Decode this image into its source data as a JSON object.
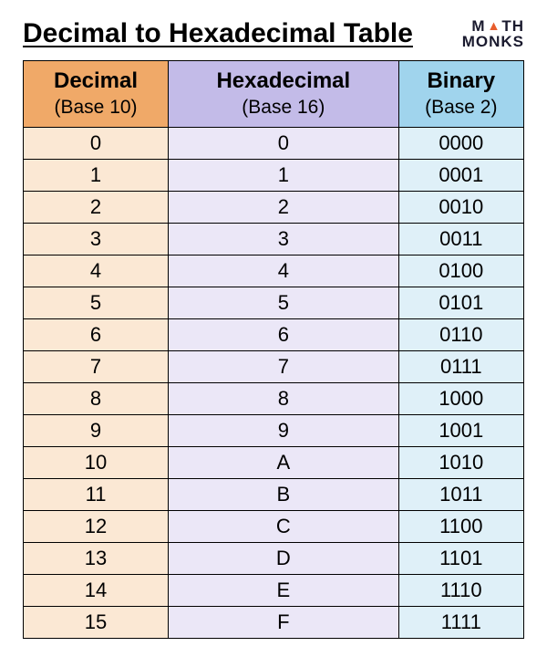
{
  "title": "Decimal to Hexadecimal Table",
  "logo": {
    "part1": "M",
    "part2": "TH",
    "line2": "MONKS"
  },
  "columns": [
    {
      "title": "Decimal",
      "sub": "(Base 10)"
    },
    {
      "title": "Hexadecimal",
      "sub": "(Base 16)"
    },
    {
      "title": "Binary",
      "sub": "(Base 2)"
    }
  ],
  "chart_data": {
    "type": "table",
    "columns": [
      "Decimal",
      "Hexadecimal",
      "Binary"
    ],
    "rows": [
      [
        "0",
        "0",
        "0000"
      ],
      [
        "1",
        "1",
        "0001"
      ],
      [
        "2",
        "2",
        "0010"
      ],
      [
        "3",
        "3",
        "0011"
      ],
      [
        "4",
        "4",
        "0100"
      ],
      [
        "5",
        "5",
        "0101"
      ],
      [
        "6",
        "6",
        "0110"
      ],
      [
        "7",
        "7",
        "0111"
      ],
      [
        "8",
        "8",
        "1000"
      ],
      [
        "9",
        "9",
        "1001"
      ],
      [
        "10",
        "A",
        "1010"
      ],
      [
        "11",
        "B",
        "1011"
      ],
      [
        "12",
        "C",
        "1100"
      ],
      [
        "13",
        "D",
        "1101"
      ],
      [
        "14",
        "E",
        "1110"
      ],
      [
        "15",
        "F",
        "1111"
      ]
    ]
  }
}
